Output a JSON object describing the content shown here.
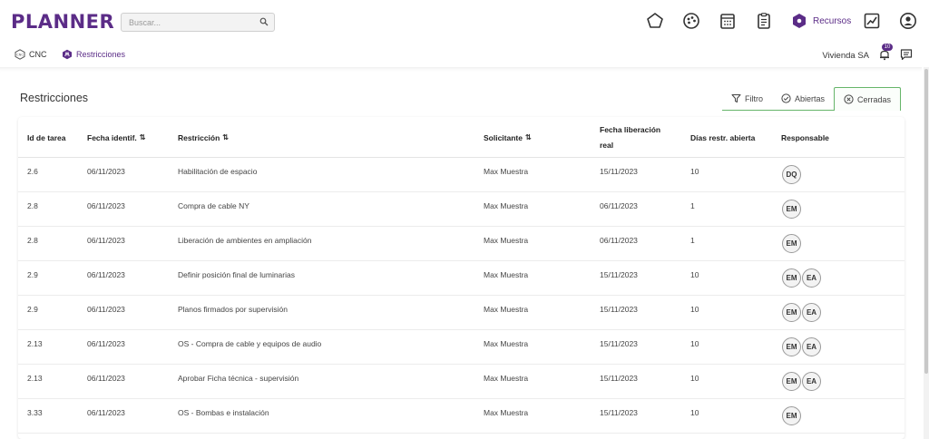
{
  "app": {
    "logo": "PLANNER"
  },
  "search": {
    "placeholder": "Buscar..."
  },
  "nav": {
    "icons": [
      "pentagon-icon",
      "palette-icon",
      "calendar-icon",
      "clipboard-icon"
    ],
    "recursos_label": "Recursos",
    "extra_icons": [
      "chart-icon",
      "user-circle-icon"
    ]
  },
  "breadcrumb": {
    "items": [
      {
        "label": "CNC",
        "icon": "cnc-icon"
      },
      {
        "label": "Restricciones",
        "icon": "restriction-icon"
      }
    ]
  },
  "subbar": {
    "company": "Vivienda SA",
    "notifications": "10"
  },
  "page": {
    "title": "Restricciones"
  },
  "filters": {
    "filtro": "Filtro",
    "abiertas": "Abiertas",
    "cerradas": "Cerradas",
    "active": "Cerradas"
  },
  "table": {
    "headers": {
      "id": "Id de tarea",
      "fecha": "Fecha identif.",
      "restriccion": "Restricción",
      "solicitante": "Solicitante",
      "liberacion_1": "Fecha liberación",
      "liberacion_2": "real",
      "dias": "Días restr. abierta",
      "responsable": "Responsable"
    },
    "rows": [
      {
        "id": "2.6",
        "fecha": "06/11/2023",
        "restriccion": "Habilitación de espacio",
        "solicitante": "Max Muestra",
        "liberacion": "15/11/2023",
        "dias": "10",
        "responsables": [
          "DQ"
        ]
      },
      {
        "id": "2.8",
        "fecha": "06/11/2023",
        "restriccion": "Compra de cable NY",
        "solicitante": "Max Muestra",
        "liberacion": "06/11/2023",
        "dias": "1",
        "responsables": [
          "EM"
        ]
      },
      {
        "id": "2.8",
        "fecha": "06/11/2023",
        "restriccion": "Liberación de ambientes en ampliación",
        "solicitante": "Max Muestra",
        "liberacion": "06/11/2023",
        "dias": "1",
        "responsables": [
          "EM"
        ]
      },
      {
        "id": "2.9",
        "fecha": "06/11/2023",
        "restriccion": "Definir posición final de luminarias",
        "solicitante": "Max Muestra",
        "liberacion": "15/11/2023",
        "dias": "10",
        "responsables": [
          "EM",
          "EA"
        ]
      },
      {
        "id": "2.9",
        "fecha": "06/11/2023",
        "restriccion": "Planos firmados por supervisión",
        "solicitante": "Max Muestra",
        "liberacion": "15/11/2023",
        "dias": "10",
        "responsables": [
          "EM",
          "EA"
        ]
      },
      {
        "id": "2.13",
        "fecha": "06/11/2023",
        "restriccion": "OS - Compra de cable y equipos de audio",
        "solicitante": "Max Muestra",
        "liberacion": "15/11/2023",
        "dias": "10",
        "responsables": [
          "EM",
          "EA"
        ]
      },
      {
        "id": "2.13",
        "fecha": "06/11/2023",
        "restriccion": "Aprobar Ficha técnica - supervisión",
        "solicitante": "Max Muestra",
        "liberacion": "15/11/2023",
        "dias": "10",
        "responsables": [
          "EM",
          "EA"
        ]
      },
      {
        "id": "3.33",
        "fecha": "06/11/2023",
        "restriccion": "OS - Bombas e instalación",
        "solicitante": "Max Muestra",
        "liberacion": "15/11/2023",
        "dias": "10",
        "responsables": [
          "EM"
        ]
      }
    ]
  },
  "colors": {
    "brand": "#5b2c87",
    "active_tab_border": "#66b56a"
  }
}
